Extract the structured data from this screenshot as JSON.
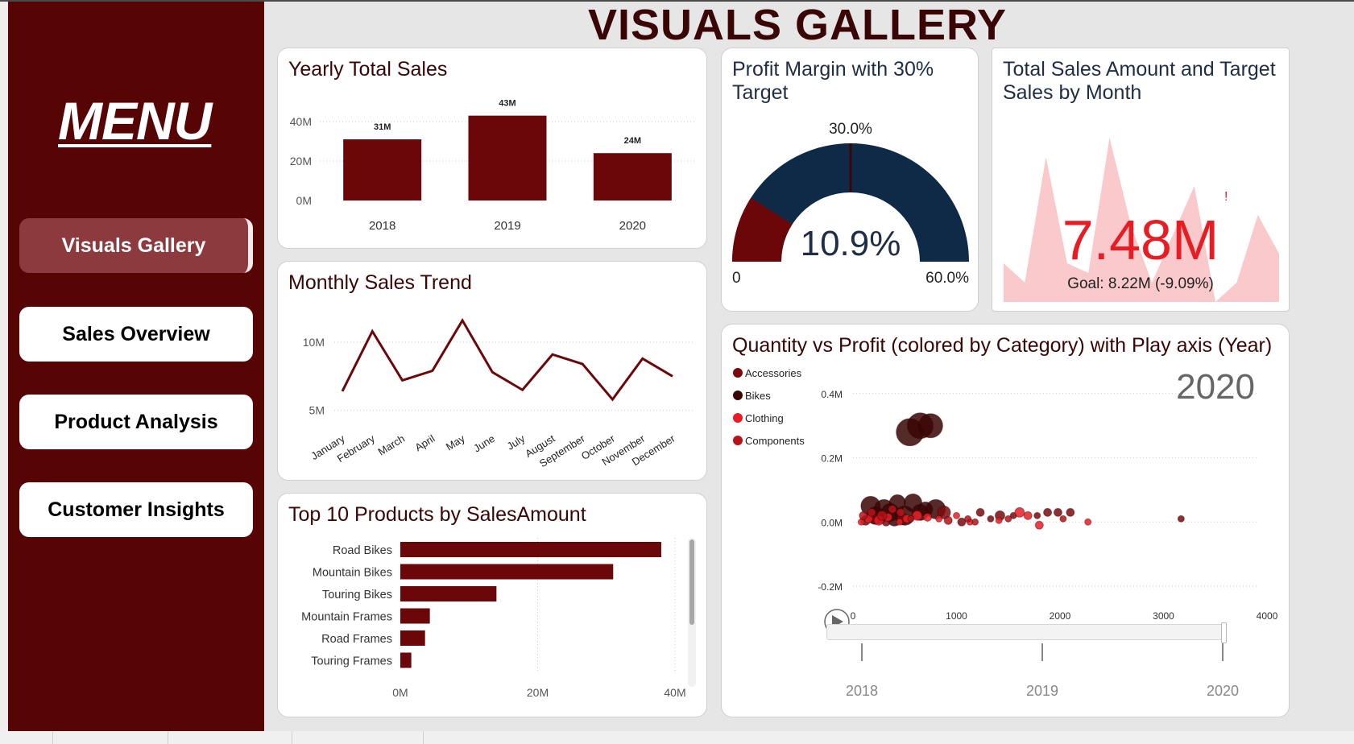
{
  "page": {
    "title": "VISUALS GALLERY"
  },
  "sidebar": {
    "menu_title": "MENU",
    "items": [
      {
        "label": "Visuals Gallery",
        "active": true
      },
      {
        "label": "Sales Overview",
        "active": false
      },
      {
        "label": "Product Analysis",
        "active": false
      },
      {
        "label": "Customer Insights",
        "active": false
      }
    ]
  },
  "colors": {
    "accent": "#6b0709",
    "sidebar": "#570405",
    "gauge_fill": "#0e2a47",
    "kpi_red": "#e81d24",
    "kpi_area": "#f9c9cb"
  },
  "cards": {
    "yearly": {
      "title": "Yearly Total Sales"
    },
    "monthly": {
      "title": "Monthly Sales Trend"
    },
    "top10": {
      "title": "Top 10 Products by SalesAmount"
    },
    "gauge": {
      "title_line1": "Profit Margin with 30%",
      "title_line2": "Target",
      "target_label": "30.0%",
      "value_label": "10.9%",
      "min_label": "0",
      "max_label": "60.0%"
    },
    "kpi": {
      "title_line1": "Total Sales Amount and Target",
      "title_line2": "Sales by Month",
      "value": "7.48M",
      "indicator": "!",
      "goal": "Goal: 8.22M (-9.09%)"
    },
    "scatter": {
      "title": "Quantity vs Profit (colored by Category) with Play axis (Year)",
      "year_label": "2020",
      "play_icon": "play-icon"
    }
  },
  "chart_data": [
    {
      "id": "yearly",
      "type": "bar",
      "categories": [
        "2018",
        "2019",
        "2020"
      ],
      "values": [
        31,
        43,
        24
      ],
      "data_labels": [
        "31M",
        "43M",
        "24M"
      ],
      "y_ticks": [
        "0M",
        "20M",
        "40M"
      ],
      "ylim": [
        0,
        40
      ],
      "unit": "M",
      "grid": true
    },
    {
      "id": "monthly",
      "type": "line",
      "categories": [
        "January",
        "February",
        "March",
        "April",
        "May",
        "June",
        "July",
        "August",
        "September",
        "October",
        "November",
        "December"
      ],
      "values": [
        6.4,
        10.8,
        7.2,
        7.9,
        11.6,
        7.8,
        6.5,
        9.1,
        8.4,
        5.8,
        8.8,
        7.5
      ],
      "y_ticks": [
        "5M",
        "10M"
      ],
      "ylim": [
        3.5,
        12.6
      ],
      "unit": "M",
      "grid": true
    },
    {
      "id": "top10",
      "type": "bar",
      "orientation": "horizontal",
      "categories": [
        "Road Bikes",
        "Mountain Bikes",
        "Touring Bikes",
        "Mountain Frames",
        "Road Frames",
        "Touring Frames"
      ],
      "values": [
        38,
        31,
        14,
        4.3,
        3.6,
        1.6
      ],
      "x_ticks": [
        "0M",
        "20M",
        "40M"
      ],
      "xlim": [
        0,
        40
      ],
      "unit": "M",
      "grid": true
    },
    {
      "id": "gauge",
      "type": "gauge",
      "value": 10.9,
      "target": 30.0,
      "min": 0,
      "max": 60.0,
      "unit": "%"
    },
    {
      "id": "kpi",
      "type": "area",
      "values": [
        0.2,
        0.1,
        0.75,
        0.2,
        0.15,
        0.85,
        0.4,
        0.1,
        0.35,
        0.6,
        0.0,
        0.1,
        0.45,
        0.25
      ],
      "kpi_value": 7.48,
      "goal": 8.22,
      "goal_change_pct": -9.09
    },
    {
      "id": "scatter",
      "type": "scatter",
      "xlabel": "",
      "ylabel": "",
      "x_ticks": [
        "0",
        "1000",
        "2000",
        "3000",
        "4000"
      ],
      "y_ticks": [
        "-0.2M",
        "0.0M",
        "0.2M",
        "0.4M"
      ],
      "xlim": [
        0,
        4000
      ],
      "ylim": [
        -0.2,
        0.45
      ],
      "legend": {
        "placement": "top-left",
        "items": [
          {
            "name": "Accessories",
            "color": "#7a0a0e"
          },
          {
            "name": "Bikes",
            "color": "#3a0505"
          },
          {
            "name": "Clothing",
            "color": "#e81d24"
          },
          {
            "name": "Components",
            "color": "#b51318"
          }
        ]
      },
      "play_axis": {
        "years": [
          "2018",
          "2019",
          "2020"
        ],
        "current": "2020"
      },
      "series": [
        {
          "name": "Bikes",
          "color": "#3a0505",
          "points": [
            [
              550,
              0.28,
              17
            ],
            [
              650,
              0.3,
              16
            ],
            [
              750,
              0.3,
              15
            ],
            [
              170,
              0.05,
              12
            ],
            [
              220,
              0.02,
              11
            ],
            [
              300,
              0.04,
              12
            ],
            [
              360,
              0.03,
              11
            ],
            [
              430,
              0.06,
              10
            ],
            [
              500,
              0.02,
              12
            ],
            [
              580,
              0.06,
              11
            ],
            [
              650,
              0.03,
              10
            ],
            [
              700,
              0.04,
              9
            ],
            [
              800,
              0.04,
              12
            ],
            [
              260,
              0.015,
              8
            ],
            [
              400,
              0.01,
              9
            ]
          ]
        },
        {
          "name": "Accessories",
          "color": "#7a0a0e",
          "points": [
            [
              120,
              0.005,
              6
            ],
            [
              200,
              0.01,
              6
            ],
            [
              320,
              0.0,
              5
            ],
            [
              480,
              0.01,
              7
            ],
            [
              880,
              0.03,
              8
            ],
            [
              1050,
              0.0,
              5
            ],
            [
              1230,
              0.03,
              5
            ],
            [
              1330,
              0.01,
              4
            ],
            [
              1420,
              0.02,
              6
            ],
            [
              1550,
              0.02,
              4
            ],
            [
              1780,
              0.02,
              4
            ],
            [
              1880,
              0.03,
              5
            ],
            [
              1980,
              0.03,
              5
            ],
            [
              2100,
              0.03,
              5
            ],
            [
              3170,
              0.01,
              4
            ]
          ]
        },
        {
          "name": "Clothing",
          "color": "#e81d24",
          "points": [
            [
              80,
              0.0,
              4
            ],
            [
              150,
              0.01,
              5
            ],
            [
              250,
              0.005,
              6
            ],
            [
              340,
              0.015,
              5
            ],
            [
              450,
              0.0,
              4
            ],
            [
              520,
              0.01,
              5
            ],
            [
              620,
              0.02,
              6
            ],
            [
              720,
              0.015,
              5
            ],
            [
              830,
              0.01,
              4
            ],
            [
              1000,
              0.02,
              4
            ],
            [
              1130,
              0.0,
              4
            ],
            [
              1410,
              0.005,
              4
            ],
            [
              1610,
              0.03,
              6
            ],
            [
              1690,
              0.02,
              5
            ],
            [
              1800,
              -0.01,
              5
            ],
            [
              2270,
              0.0,
              4
            ]
          ]
        },
        {
          "name": "Components",
          "color": "#b51318",
          "points": [
            [
              100,
              0.02,
              5
            ],
            [
              180,
              0.03,
              5
            ],
            [
              280,
              0.02,
              6
            ],
            [
              380,
              0.04,
              5
            ],
            [
              460,
              0.03,
              5
            ],
            [
              560,
              0.01,
              4
            ],
            [
              920,
              0.005,
              5
            ],
            [
              1110,
              0.01,
              4
            ],
            [
              1180,
              0.0,
              4
            ],
            [
              1500,
              0.01,
              4
            ],
            [
              2030,
              0.01,
              4
            ]
          ]
        }
      ]
    }
  ]
}
